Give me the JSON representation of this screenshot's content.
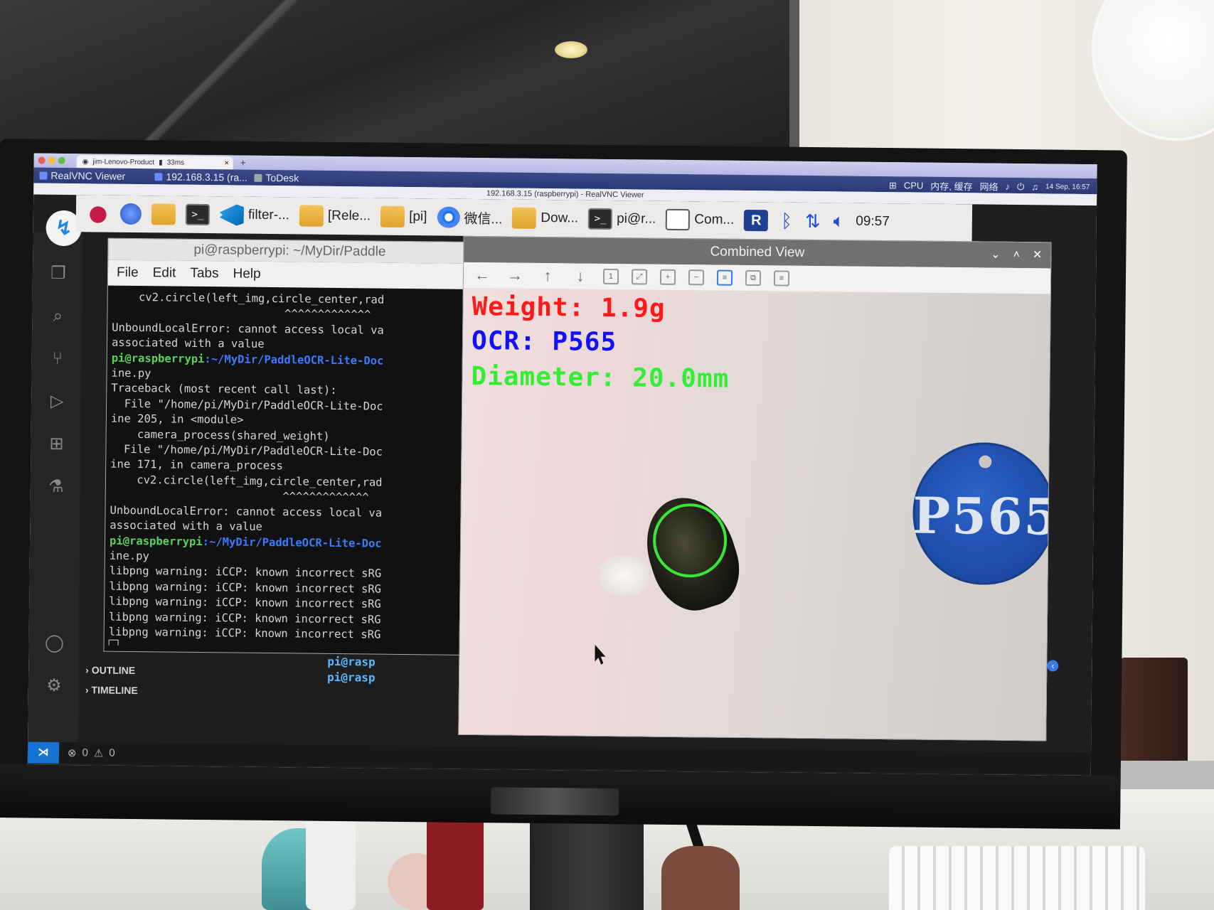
{
  "client_browser": {
    "tab_title": "jim-Lenovo-Product",
    "tab_latency": "33ms"
  },
  "client_taskbar": {
    "items": [
      "RealVNC Viewer",
      "192.168.3.15 (ra...",
      "ToDesk"
    ],
    "tray": [
      "CPU",
      "内存, 缓存",
      "网络"
    ],
    "datetime": "14 Sep, 16:57"
  },
  "vnc_window": {
    "title": "192.168.3.15 (raspberrypi) - RealVNC Viewer"
  },
  "pi_panel": {
    "tasks": [
      "filter-...",
      "[Rele...",
      "[pi]",
      "微信...",
      "Dow...",
      "pi@r...",
      "Com..."
    ],
    "clock": "09:57"
  },
  "terminal": {
    "title": "pi@raspberrypi: ~/MyDir/Paddle",
    "menu": [
      "File",
      "Edit",
      "Tabs",
      "Help"
    ],
    "lines": [
      {
        "t": "    cv2.circle(left_img,circle_center,rad"
      },
      {
        "t": "                          ^^^^^^^^^^^^^"
      },
      {
        "t": "UnboundLocalError: cannot access local va"
      },
      {
        "t": "associated with a value"
      },
      {
        "user": "pi@raspberrypi",
        "path": ":~/MyDir/PaddleOCR-Lite-Doc"
      },
      {
        "t": "ine.py"
      },
      {
        "t": "Traceback (most recent call last):"
      },
      {
        "t": "  File \"/home/pi/MyDir/PaddleOCR-Lite-Doc"
      },
      {
        "t": "ine 205, in <module>"
      },
      {
        "t": "    camera_process(shared_weight)"
      },
      {
        "t": "  File \"/home/pi/MyDir/PaddleOCR-Lite-Doc"
      },
      {
        "t": "ine 171, in camera_process"
      },
      {
        "t": "    cv2.circle(left_img,circle_center,rad"
      },
      {
        "t": "                          ^^^^^^^^^^^^^"
      },
      {
        "t": "UnboundLocalError: cannot access local va"
      },
      {
        "t": "associated with a value"
      },
      {
        "user": "pi@raspberrypi",
        "path": ":~/MyDir/PaddleOCR-Lite-Doc"
      },
      {
        "t": "ine.py"
      },
      {
        "t": "libpng warning: iCCP: known incorrect sRG"
      },
      {
        "t": "libpng warning: iCCP: known incorrect sRG"
      },
      {
        "t": "libpng warning: iCCP: known incorrect sRG"
      },
      {
        "t": "libpng warning: iCCP: known incorrect sRG"
      },
      {
        "t": "libpng warning: iCCP: known incorrect sRG"
      }
    ]
  },
  "combined_view": {
    "title": "Combined View",
    "weight": "Weight: 1.9g",
    "ocr": "OCR: P565",
    "diameter": "Diameter: 20.0mm",
    "tag_text": "P565"
  },
  "vscode": {
    "outline": "OUTLINE",
    "timeline": "TIMELINE",
    "term_lines": [
      "pi@rasp",
      "pi@rasp"
    ],
    "errors": "0",
    "warnings": "0"
  }
}
